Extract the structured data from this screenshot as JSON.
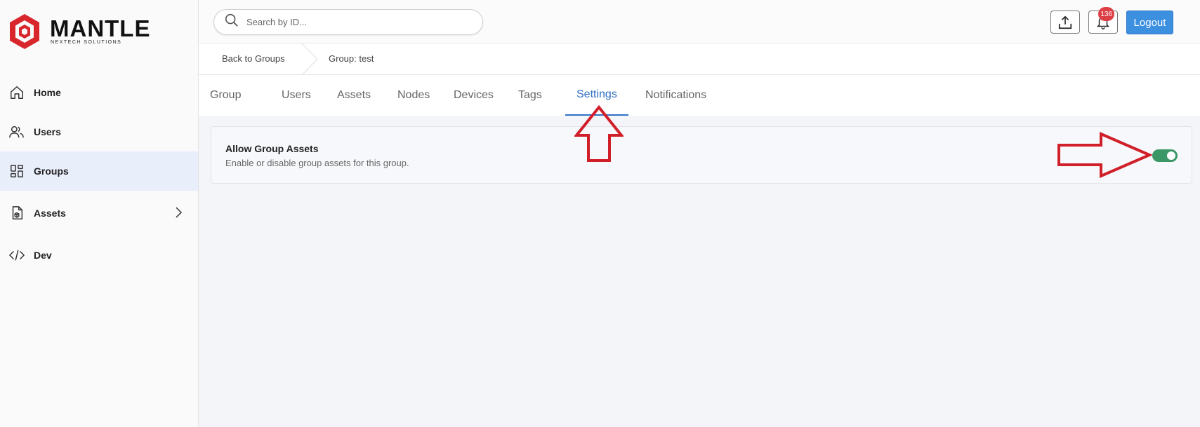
{
  "brand": {
    "name": "MANTLE",
    "tagline": "NEXTECH SOLUTIONS"
  },
  "sidebar": {
    "items": [
      {
        "label": "Home",
        "icon": "home-icon"
      },
      {
        "label": "Users",
        "icon": "users-icon"
      },
      {
        "label": "Groups",
        "icon": "grid-icon",
        "active": true
      },
      {
        "label": "Assets",
        "icon": "assets-icon",
        "has_submenu": true
      },
      {
        "label": "Dev",
        "icon": "code-icon"
      }
    ]
  },
  "header": {
    "search": {
      "placeholder": "Search by ID..."
    },
    "notifications_count": "136",
    "logout_label": "Logout"
  },
  "breadcrumb": {
    "back": "Back to Groups",
    "current": "Group: test"
  },
  "tabs": [
    {
      "label": "Group"
    },
    {
      "label": "Users"
    },
    {
      "label": "Assets"
    },
    {
      "label": "Nodes"
    },
    {
      "label": "Devices"
    },
    {
      "label": "Tags"
    },
    {
      "label": "Settings",
      "active": true
    },
    {
      "label": "Notifications"
    }
  ],
  "settings": {
    "allow_group_assets": {
      "title": "Allow Group Assets",
      "description": "Enable or disable group assets for this group.",
      "enabled": true
    }
  },
  "colors": {
    "accent": "#2f6fc4",
    "logout": "#3d8fe0",
    "toggle_on": "#3b9866",
    "badge": "#dc3f46",
    "annotation": "#d11f2a"
  }
}
